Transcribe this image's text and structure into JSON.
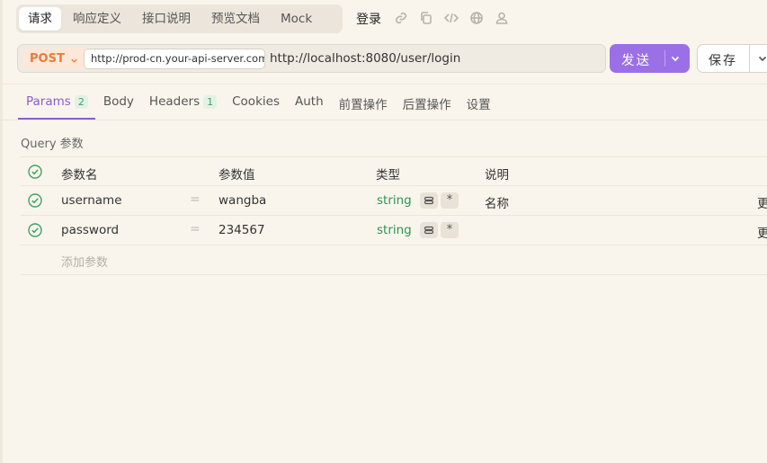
{
  "top_tabs": [
    {
      "label": "请求",
      "active": true
    },
    {
      "label": "响应定义",
      "active": false
    },
    {
      "label": "接口说明",
      "active": false
    },
    {
      "label": "预览文档",
      "active": false
    },
    {
      "label": "Mock",
      "active": false
    }
  ],
  "login_label": "登录",
  "toolbar_icons": [
    "link-icon",
    "copy-icon",
    "code-icon",
    "globe-icon",
    "user-icon"
  ],
  "request": {
    "method": "POST",
    "server": "http://prod-cn.your-api-server.com",
    "path": "http://localhost:8080/user/login"
  },
  "send_label": "发送",
  "save_label": "保存",
  "sub_tabs": [
    {
      "label": "Params",
      "badge": "2",
      "active": true
    },
    {
      "label": "Body",
      "badge": "",
      "active": false
    },
    {
      "label": "Headers",
      "badge": "1",
      "active": false
    },
    {
      "label": "Cookies",
      "badge": "",
      "active": false
    },
    {
      "label": "Auth",
      "badge": "",
      "active": false
    },
    {
      "label": "前置操作",
      "badge": "",
      "active": false
    },
    {
      "label": "后置操作",
      "badge": "",
      "active": false
    },
    {
      "label": "设置",
      "badge": "",
      "active": false
    }
  ],
  "query_title": "Query 参数",
  "table": {
    "headers": {
      "name": "参数名",
      "value": "参数值",
      "type": "类型",
      "desc": "说明"
    },
    "rows": [
      {
        "name": "username",
        "eq": "=",
        "value": "wangba",
        "type": "string",
        "star": "*",
        "desc": "名称",
        "more": "更"
      },
      {
        "name": "password",
        "eq": "=",
        "value": "234567",
        "type": "string",
        "star": "*",
        "desc": "",
        "more": "更"
      }
    ],
    "add_placeholder": "添加参数"
  },
  "colors": {
    "background": "#faf5ec",
    "accent": "#9b70e6",
    "method": "#ea7b3a",
    "type": "#2f9355",
    "check": "#3aa564"
  }
}
